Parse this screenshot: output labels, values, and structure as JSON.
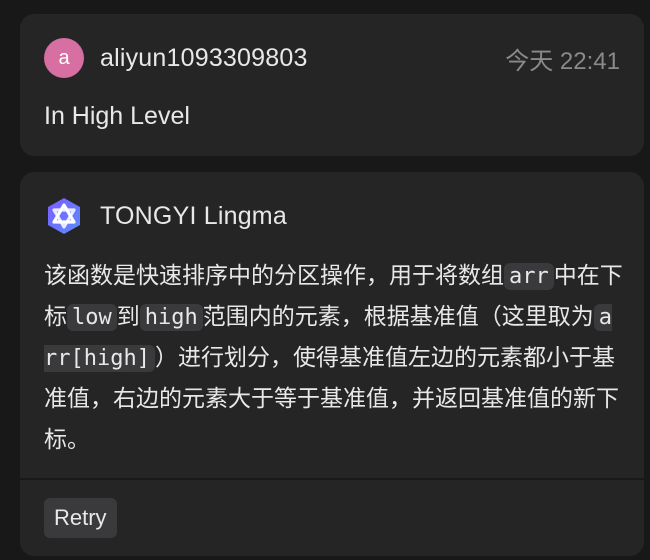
{
  "user_message": {
    "avatar_letter": "a",
    "username": "aliyun1093309803",
    "timestamp": "今天 22:41",
    "text": "In High Level"
  },
  "assistant_message": {
    "assistant_name": "TONGYI Lingma",
    "logo_icon": "tongyi-lingma-logo-icon",
    "reply": {
      "t1": "该函数是快速排序中的分区操作，用于将数组",
      "c1": "arr",
      "t2": "中在下标",
      "c2": "low",
      "t3": "到",
      "c3": "high",
      "t4": "范围内的元素，根据基准值（这里取为",
      "c4": "arr[high]",
      "t5": "）进行划分，使得基准值左边的元素都小于基准值，右边的元素大于等于基准值，并返回基准值的新下标。"
    },
    "retry_label": "Retry"
  },
  "colors": {
    "background": "#181818",
    "card": "#252526",
    "avatar": "#d86fa3",
    "logo_gradient_start": "#7b5cff",
    "logo_gradient_end": "#5b8dff",
    "code_bg": "#3a3a3c",
    "muted_text": "#8a8a8a"
  }
}
